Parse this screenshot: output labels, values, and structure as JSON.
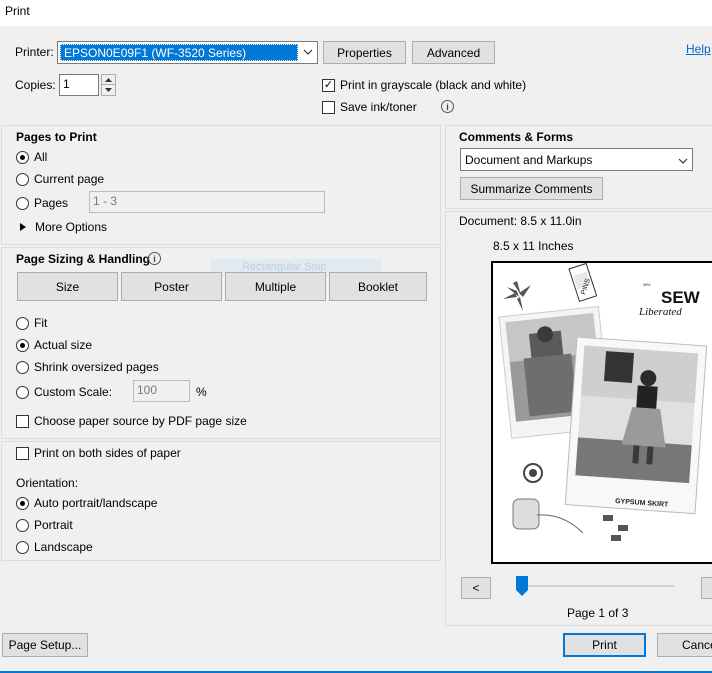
{
  "window": {
    "title": "Print",
    "help_link": "Help"
  },
  "printer": {
    "label": "Printer:",
    "selected": "EPSON0E09F1 (WF-3520 Series)",
    "properties_button": "Properties",
    "advanced_button": "Advanced"
  },
  "copies": {
    "label": "Copies:",
    "value": "1"
  },
  "options": {
    "grayscale_label": "Print in grayscale (black and white)",
    "grayscale_checked": true,
    "save_ink_label": "Save ink/toner",
    "save_ink_checked": false
  },
  "pages_to_print": {
    "title": "Pages to Print",
    "all": "All",
    "current_page": "Current page",
    "pages": "Pages",
    "pages_value": "1 - 3",
    "more_options": "More Options"
  },
  "sizing": {
    "title": "Page Sizing & Handling",
    "tooltip_ghost": "Rectangular Snip",
    "buttons": [
      "Size",
      "Poster",
      "Multiple",
      "Booklet"
    ],
    "fit": "Fit",
    "actual_size": "Actual size",
    "shrink": "Shrink oversized pages",
    "custom_scale": "Custom Scale:",
    "custom_scale_value": "100",
    "percent": "%",
    "paper_source": "Choose paper source by PDF page size"
  },
  "duplex": {
    "label": "Print on both sides of paper"
  },
  "orientation": {
    "label": "Orientation:",
    "auto": "Auto portrait/landscape",
    "portrait": "Portrait",
    "landscape": "Landscape"
  },
  "comments": {
    "title": "Comments & Forms",
    "selected": "Document and Markups",
    "summarize_button": "Summarize Comments"
  },
  "preview": {
    "document_size": "Document: 8.5 x 11.0in",
    "paper_size": "8.5 x 11 Inches",
    "prev_button": "<",
    "page_indicator": "Page 1 of 3",
    "brand_small": "sew",
    "brand_sew": "SEW",
    "brand_liberated": "Liberated",
    "pattern_name": "GYPSUM SKIRT",
    "pins_label": "PINS"
  },
  "footer": {
    "page_setup": "Page Setup...",
    "print": "Print",
    "cancel": "Cancel"
  },
  "colors": {
    "accent": "#0078d7",
    "selection": "#0078d7"
  }
}
